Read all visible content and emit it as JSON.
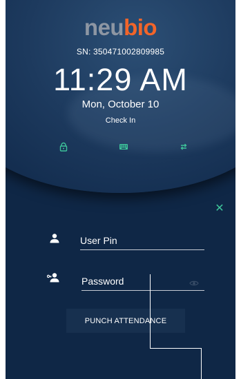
{
  "app": {
    "logo_part1": "neu",
    "logo_part2": "bio",
    "serial": "SN: 350471002809985"
  },
  "clock": {
    "time": "11:29 AM",
    "date": "Mon, October 10",
    "mode": "Check In"
  },
  "mode_icons": [
    {
      "name": "lock-icon"
    },
    {
      "name": "keyboard-icon"
    },
    {
      "name": "switch-icon"
    }
  ],
  "form": {
    "user_pin_placeholder": "User Pin",
    "password_placeholder": "Password",
    "punch_label": "PUNCH ATTENDANCE"
  },
  "colors": {
    "background": "#0f2746",
    "accent_teal": "#3ec49a",
    "logo_gray": "#8d96a3",
    "logo_orange": "#f2652a"
  }
}
